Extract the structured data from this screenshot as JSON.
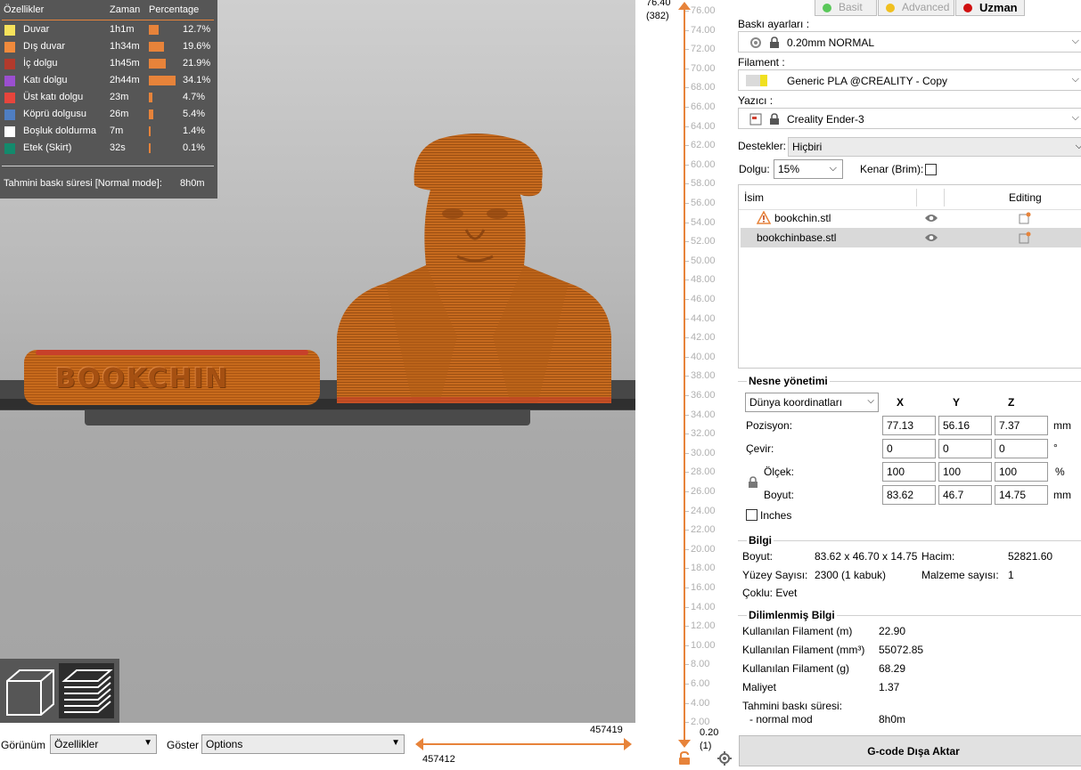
{
  "legend": {
    "headers": {
      "feature": "Özellikler",
      "time": "Zaman",
      "percentage": "Percentage"
    },
    "rows": [
      {
        "name": "Duvar",
        "time": "1h1m",
        "pct": "12.7%",
        "color": "#f6e25b",
        "fraction": 0.127
      },
      {
        "name": "Dış duvar",
        "time": "1h34m",
        "pct": "19.6%",
        "color": "#f08a3c",
        "fraction": 0.196
      },
      {
        "name": "İç dolgu",
        "time": "1h45m",
        "pct": "21.9%",
        "color": "#b23a2c",
        "fraction": 0.219
      },
      {
        "name": "Katı dolgu",
        "time": "2h44m",
        "pct": "34.1%",
        "color": "#9b4fd0",
        "fraction": 0.341
      },
      {
        "name": "Üst katı dolgu",
        "time": "23m",
        "pct": "4.7%",
        "color": "#e8453c",
        "fraction": 0.047
      },
      {
        "name": "Köprü dolgusu",
        "time": "26m",
        "pct": "5.4%",
        "color": "#4f7ec2",
        "fraction": 0.054
      },
      {
        "name": "Boşluk doldurma",
        "time": "7m",
        "pct": "1.4%",
        "color": "#ffffff",
        "fraction": 0.014
      },
      {
        "name": "Etek (Skirt)",
        "time": "32s",
        "pct": "0.1%",
        "color": "#138a6c",
        "fraction": 0.001
      }
    ],
    "total_label": "Tahmini baskı süresi [Normal mode]:",
    "total_value": "8h0m"
  },
  "bottom": {
    "view_label": "Görünüm",
    "view_value": "Özellikler",
    "show_label": "Göster",
    "show_value": "Options",
    "hslider_max": "457419",
    "hslider_min": "457412"
  },
  "vslider": {
    "top_height": "76.40",
    "top_layer": "(382)",
    "bottom_height": "0.20",
    "bottom_layer": "(1)",
    "ticks": [
      "76.00",
      "74.00",
      "72.00",
      "70.00",
      "68.00",
      "66.00",
      "64.00",
      "62.00",
      "60.00",
      "58.00",
      "56.00",
      "54.00",
      "52.00",
      "50.00",
      "48.00",
      "46.00",
      "44.00",
      "42.00",
      "40.00",
      "38.00",
      "36.00",
      "34.00",
      "32.00",
      "30.00",
      "28.00",
      "26.00",
      "24.00",
      "22.00",
      "20.00",
      "18.00",
      "16.00",
      "14.00",
      "12.00",
      "10.00",
      "8.00",
      "6.00",
      "4.00",
      "2.00"
    ]
  },
  "panel": {
    "modes": [
      {
        "label": "Basit",
        "color": "#5ac85a",
        "active": false
      },
      {
        "label": "Advanced",
        "color": "#f0c020",
        "active": false
      },
      {
        "label": "Uzman",
        "color": "#d01010",
        "active": true
      }
    ],
    "print_settings_label": "Baskı ayarları :",
    "print_settings_value": "0.20mm NORMAL",
    "filament_label": "Filament :",
    "filament_value": "Generic PLA @CREALITY - Copy",
    "printer_label": "Yazıcı :",
    "printer_value": "Creality Ender-3",
    "supports_label": "Destekler:",
    "supports_value": "Hiçbiri",
    "infill_label": "Dolgu:",
    "infill_value": "15%",
    "brim_label": "Kenar (Brim):",
    "objects": {
      "col_name": "İsim",
      "col_editing": "Editing",
      "items": [
        {
          "name": "bookchin.stl",
          "warning": true
        },
        {
          "name": "bookchinbase.stl",
          "warning": false
        }
      ]
    },
    "manipulation": {
      "title": "Nesne yönetimi",
      "coord_system": "Dünya koordinatları",
      "axes": [
        "X",
        "Y",
        "Z"
      ],
      "position_label": "Pozisyon:",
      "position": [
        "77.13",
        "56.16",
        "7.37"
      ],
      "position_unit": "mm",
      "rotate_label": "Çevir:",
      "rotate": [
        "0",
        "0",
        "0"
      ],
      "rotate_unit": "°",
      "scale_label": "Ölçek:",
      "scale": [
        "100",
        "100",
        "100"
      ],
      "scale_unit": "%",
      "size_label": "Boyut:",
      "size": [
        "83.62",
        "46.7",
        "14.75"
      ],
      "size_unit": "mm",
      "inches_label": "Inches"
    },
    "info": {
      "title": "Bilgi",
      "size_label": "Boyut:",
      "size_value": "83.62 x 46.70 x 14.75",
      "volume_label": "Hacim:",
      "volume_value": "52821.60",
      "facets_label": "Yüzey Sayısı:",
      "facets_value": "2300 (1 kabuk)",
      "materials_label": "Malzeme sayısı:",
      "materials_value": "1",
      "manifold_label": "Çoklu: Evet"
    },
    "sliced": {
      "title": "Dilimlenmiş Bilgi",
      "rows": [
        {
          "label": "Kullanılan Filament (m)",
          "value": "22.90"
        },
        {
          "label": "Kullanılan Filament (mm³)",
          "value": "55072.85"
        },
        {
          "label": "Kullanılan Filament (g)",
          "value": "68.29"
        },
        {
          "label": "Maliyet",
          "value": "1.37"
        }
      ],
      "est_label": "Tahmini baskı süresi:",
      "est_mode_label": "- normal mod",
      "est_mode_value": "8h0m"
    },
    "export_label": "G-code Dışa Aktar"
  },
  "scene": {
    "base_text": "BOOKCHIN"
  },
  "icons": [
    "cube-view-icon",
    "layers-view-icon",
    "lock-icon",
    "gear-icon",
    "warning-icon",
    "eye-icon",
    "edit-icon",
    "settings-icon",
    "printer-icon"
  ]
}
